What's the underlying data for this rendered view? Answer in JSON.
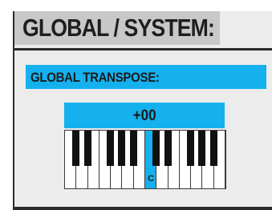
{
  "header": {
    "title": "GLOBAL / SYSTEM:"
  },
  "section": {
    "label": "GLOBAL TRANSPOSE:"
  },
  "transpose": {
    "value": "+00",
    "selected_key": "C"
  },
  "keyboard": {
    "white_key_count": 14,
    "active_white_index": 7,
    "black_after_white": [
      0,
      1,
      3,
      4,
      5,
      7,
      8,
      10,
      11,
      12
    ]
  },
  "colors": {
    "accent": "#14b1ee",
    "header_bg": "#c8c8c8",
    "panel_bg": "#ececec",
    "border": "#2b2b2b",
    "black_key": "#111111",
    "white_key": "#ffffff"
  }
}
